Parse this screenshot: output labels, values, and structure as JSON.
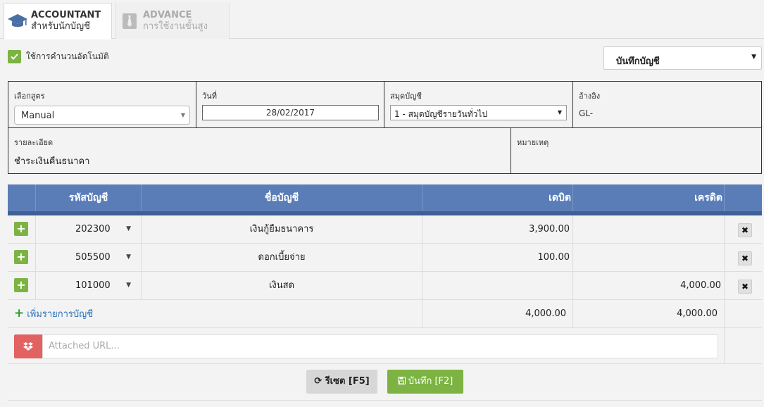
{
  "tabs": [
    {
      "title": "ACCOUNTANT",
      "subtitle": "สำหรับนักบัญชี",
      "icon": "graduation-cap-icon"
    },
    {
      "title": "ADVANCE",
      "subtitle": "การใช้งานขั้นสูง",
      "icon": "tie-icon"
    }
  ],
  "auto_calc": {
    "label": "ใช้การคำนวนอัตโนมัติ",
    "checked": true
  },
  "post_select": {
    "value": "บันทึกบัญชี"
  },
  "form": {
    "formula": {
      "caption": "เลือกสูตร",
      "value": "Manual"
    },
    "date": {
      "caption": "วันที่",
      "value": "28/02/2017"
    },
    "book": {
      "caption": "สมุดบัญชี",
      "value": "1 - สมุดบัญชีรายวันทั่วไป"
    },
    "reference": {
      "caption": "อ้างอิง",
      "value": "GL-"
    },
    "description": {
      "caption": "รายละเอียด",
      "value": "ชำระเงินคืนธนาคา"
    },
    "note": {
      "caption": "หมายเหตุ",
      "value": ""
    }
  },
  "table": {
    "headers": {
      "code": "รหัสบัญชี",
      "name": "ชื่อบัญชี",
      "debit": "เดบิต",
      "credit": "เครดิต"
    },
    "rows": [
      {
        "code": "202300",
        "name": "เงินกู้ยืมธนาคาร",
        "debit": "3,900.00",
        "credit": ""
      },
      {
        "code": "505500",
        "name": "ดอกเบี้ยจ่าย",
        "debit": "100.00",
        "credit": ""
      },
      {
        "code": "101000",
        "name": "เงินสด",
        "debit": "",
        "credit": "4,000.00"
      }
    ],
    "add_line_label": "เพิ่มรายการบัญชี",
    "total_debit": "4,000.00",
    "total_credit": "4,000.00"
  },
  "attach": {
    "placeholder": "Attached URL..."
  },
  "buttons": {
    "reset": "รีเซต [F5]",
    "save": "บันทึก [F2]"
  },
  "colors": {
    "accent_green": "#7cb342",
    "header_blue": "#5a7db8",
    "dropbox_red": "#e26161"
  }
}
